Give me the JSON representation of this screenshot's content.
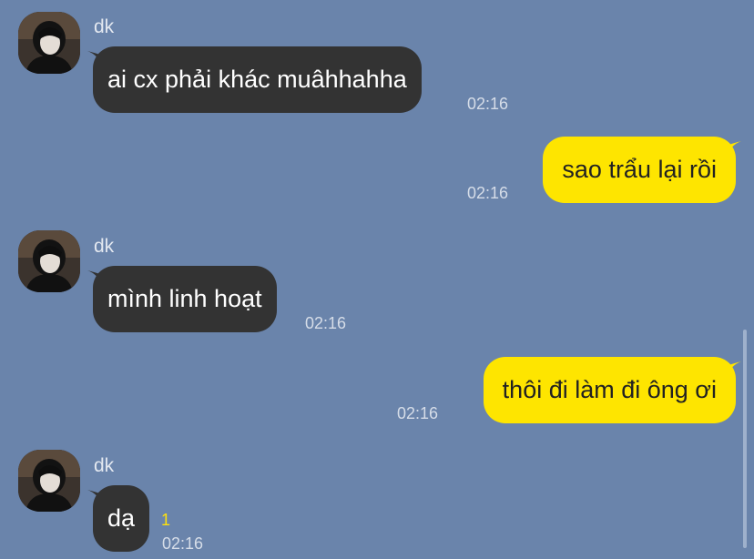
{
  "messages": [
    {
      "direction": "in",
      "sender": "dk",
      "text": "ai cx phải khác muâhhahha",
      "time": "02:16"
    },
    {
      "direction": "out",
      "text": "sao trẩu lại rồi",
      "time": "02:16"
    },
    {
      "direction": "in",
      "sender": "dk",
      "text": "mình linh hoạt",
      "time": "02:16"
    },
    {
      "direction": "out",
      "text": "thôi đi làm đi ông ơi",
      "time": "02:16"
    },
    {
      "direction": "in",
      "sender": "dk",
      "text": "dạ",
      "time": "02:16",
      "unread_count": "1"
    }
  ],
  "colors": {
    "background": "#6a84ab",
    "incoming_bubble": "#333333",
    "outgoing_bubble": "#fee500",
    "unread_count": "#ffe10a"
  },
  "icons": {
    "avatar": "profile-photo-avatar"
  }
}
